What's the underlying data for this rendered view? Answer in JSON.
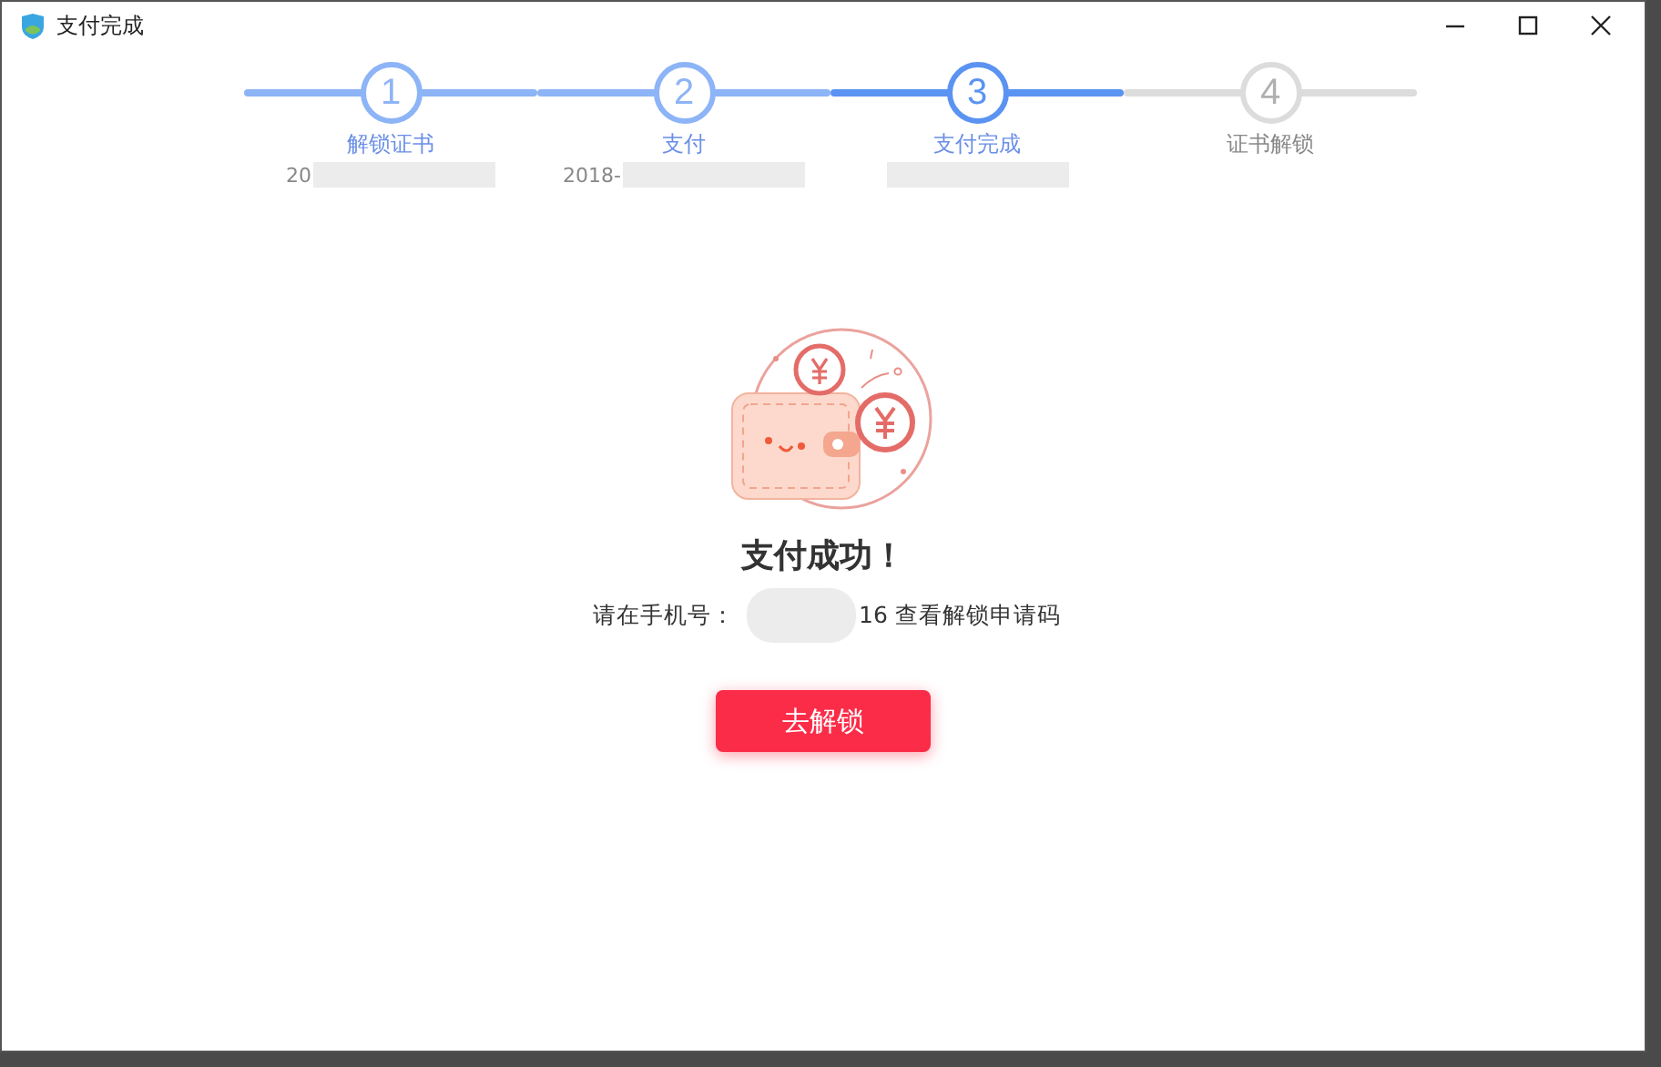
{
  "window": {
    "title": "支付完成"
  },
  "steps": [
    {
      "number": "1",
      "label": "解锁证书",
      "date": "20",
      "reached": true,
      "selected": false
    },
    {
      "number": "2",
      "label": "支付",
      "date": "2018-",
      "reached": true,
      "selected": false
    },
    {
      "number": "3",
      "label": "支付完成",
      "reached": true,
      "selected": true
    },
    {
      "number": "4",
      "label": "证书解锁",
      "reached": false,
      "selected": false
    }
  ],
  "result": {
    "title": "支付成功！",
    "phone_prefix": "请在手机号：",
    "phone_suffix": "16 查看解锁申请码"
  },
  "button": {
    "label": "去解锁"
  }
}
